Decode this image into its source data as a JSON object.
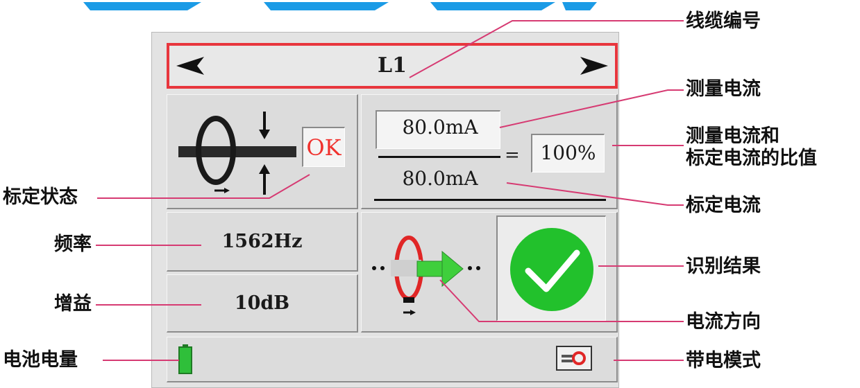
{
  "device": {
    "cable_number": "L1",
    "calibration_status": "OK",
    "measured_current": "80.0mA",
    "calibrated_current": "80.0mA",
    "equals_sign": "=",
    "ratio": "100%",
    "frequency": "1562Hz",
    "gain": "10dB"
  },
  "labels": {
    "cable_number": "线缆编号",
    "measured_current": "测量电流",
    "ratio_line1": "测量电流和",
    "ratio_line2": "标定电流的比值",
    "calibrated_current": "标定电流",
    "identify_result": "识别结果",
    "current_direction": "电流方向",
    "live_mode": "带电模式",
    "calibration_status": "标定状态",
    "frequency": "频率",
    "gain": "增益",
    "battery_level": "电池电量"
  },
  "colors": {
    "accent_red": "#e8363d",
    "ok_red": "#f0322e",
    "result_green": "#22c12c",
    "arrow_green": "#3fcf3c",
    "battery_green": "#2fbf3a",
    "leader_pink": "#d63a72"
  },
  "icons": [
    "left-arrow-icon",
    "right-arrow-icon",
    "clamp-sensor-icon",
    "direction-clamp-icon",
    "check-icon",
    "battery-icon",
    "live-mode-icon"
  ]
}
